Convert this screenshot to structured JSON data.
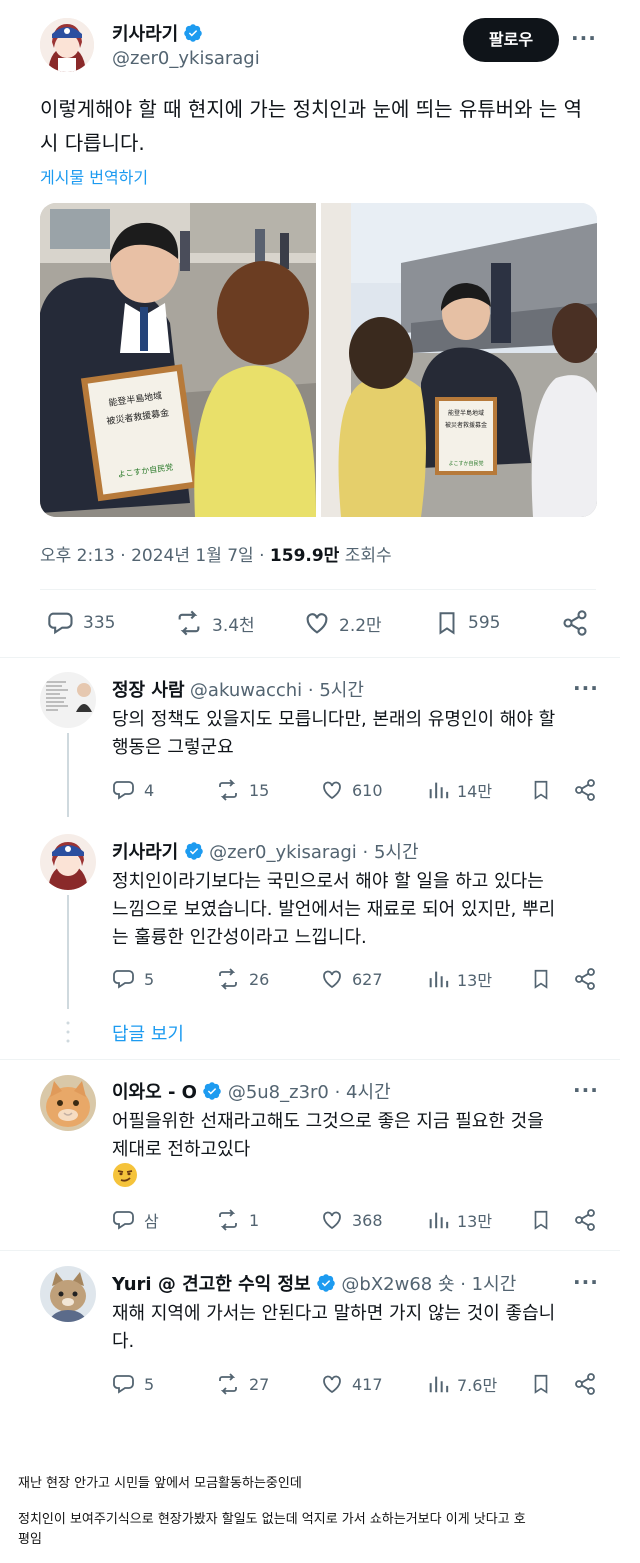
{
  "tweet": {
    "author_name": "키사라기",
    "author_handle": "@zer0_ykisaragi",
    "follow_label": "팔로우",
    "text": "이렇게해야 할 때 현지에 가는 정치인과 눈에 띄는 유튜버와 는 역시 다릅니다.",
    "translate_label": "게시물 번역하기",
    "photo_left": {
      "box_text_top": "能登半島地域",
      "box_text_mid": "被災者救援募金",
      "box_text_bottom": "よこすか自民党"
    },
    "photo_right": {
      "box_text_top": "能登半島地域",
      "box_text_mid": "被災者救援募金",
      "box_text_bottom": "よこすか自民党"
    },
    "time": "오후 2:13 · 2024년 1월 7일 · ",
    "views_count": "159.9만",
    "views_label": " 조회수",
    "replies": "335",
    "retweets": "3.4천",
    "likes": "2.2만",
    "bookmarks": "595"
  },
  "replies": [
    {
      "name": "정장 사람",
      "handle": "@akuwacchi",
      "time": " · 5시간",
      "text_line1": "당의 정책도 있을지도 모릅니다만, 본래의 유명인이 해야 할",
      "text_line2": "행동은 그렇군요",
      "replies": "4",
      "retweets": "15",
      "likes": "610",
      "views": "14만"
    },
    {
      "name": "키사라기",
      "handle": "@zer0_ykisaragi",
      "time": " · 5시간",
      "text_line1": "정치인이라기보다는 국민으로서 해야 할 일을 하고 있다는",
      "text_line2": "느낌으로 보였습니다. 발언에서는 재료로 되어 있지만, 뿌리",
      "text_line3": "는 훌륭한 인간성이라고 느낍니다.",
      "replies": "5",
      "retweets": "26",
      "likes": "627",
      "views": "13만"
    },
    {
      "name": "이와오 - O",
      "handle": "@5u8_z3r0",
      "time": " · 4시간",
      "text_line1": "어필을위한 선재라고해도 그것으로 좋은 지금 필요한 것을",
      "text_line2": "제대로 전하고있다",
      "replies": "삼",
      "retweets": "1",
      "likes": "368",
      "views": "13만"
    },
    {
      "name": "Yuri @ 견고한 수익 정보",
      "handle": "@bX2w68 숏",
      "time": " · 1시간",
      "text_line1": "재해 지역에 가서는 안된다고 말하면 가지 않는 것이 좋습니",
      "text_line2": "다.",
      "replies": "5",
      "retweets": "27",
      "likes": "417",
      "views": "7.6만"
    }
  ],
  "show_replies_label": "답글 보기",
  "caption": {
    "line1": "재난 현장 안가고 시민들 앞에서 모금활동하는중인데",
    "line2": "정치인이 보여주기식으로 현장가봤자 할일도 없는데 억지로 가서 쇼하는거보다 이게 낫다고 호",
    "line3": "평임"
  },
  "colors": {
    "accent": "#1d9bf0",
    "text": "#0f1419",
    "secondary": "#536471",
    "verified": "#1d9bf0"
  }
}
